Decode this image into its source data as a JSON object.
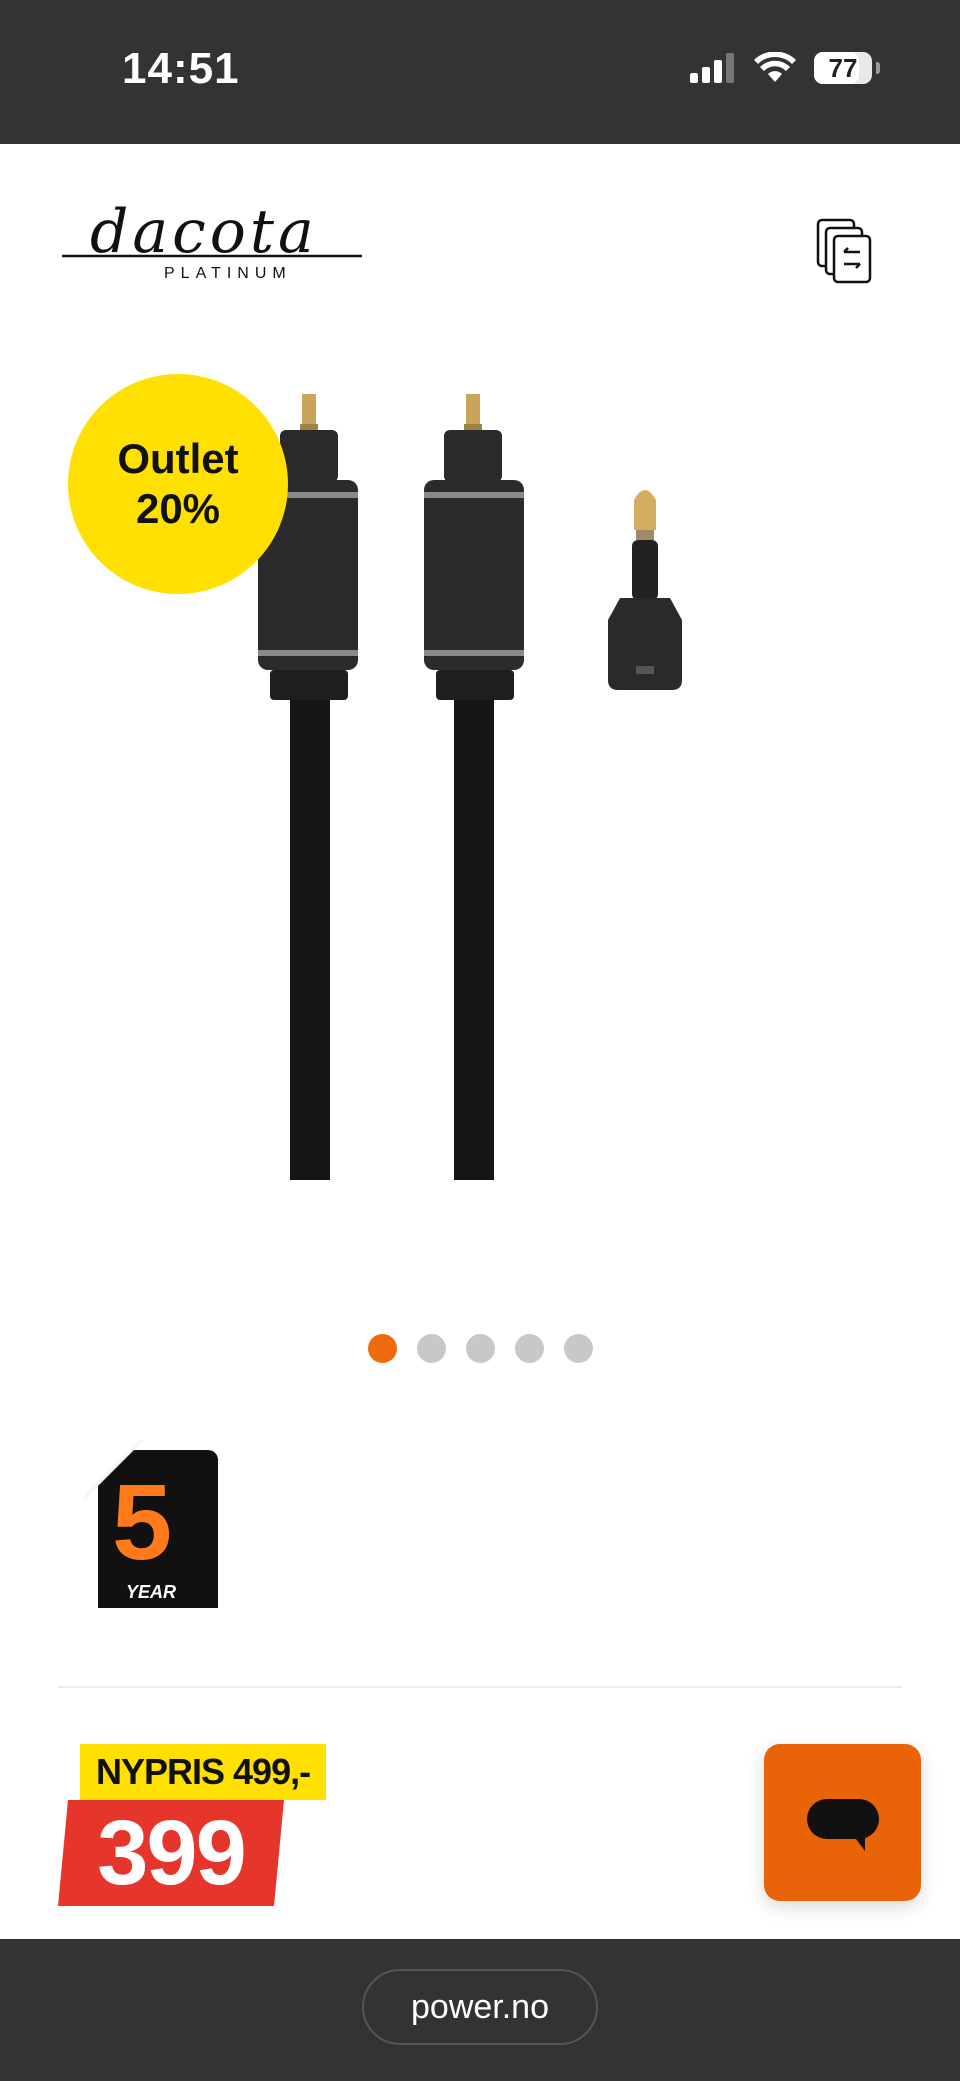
{
  "status_bar": {
    "time": "14:51",
    "battery_level": "77",
    "battery_fraction": 0.77,
    "signal_icon": "cellular-signal-icon",
    "wifi_icon": "wifi-icon"
  },
  "header": {
    "brand_logo_text": "dacota",
    "brand_logo_subtext": "PLATINUM",
    "compare_icon": "compare-icon"
  },
  "product": {
    "image_alt": "optical-cable-product-image",
    "badge": {
      "line1": "Outlet",
      "line2": "20%"
    },
    "carousel": {
      "count": 5,
      "active_index": 0
    },
    "warranty": {
      "years": "5",
      "label": "YEAR"
    }
  },
  "price": {
    "old_price_label": "NYPRIS 499,-",
    "current_price": "399"
  },
  "chat": {
    "icon": "chat-icon"
  },
  "browser": {
    "url": "power.no"
  },
  "colors": {
    "accent_orange": "#ee6b0d",
    "badge_yellow": "#ffe000",
    "price_red": "#e6352b",
    "dark_bar": "#333333"
  }
}
